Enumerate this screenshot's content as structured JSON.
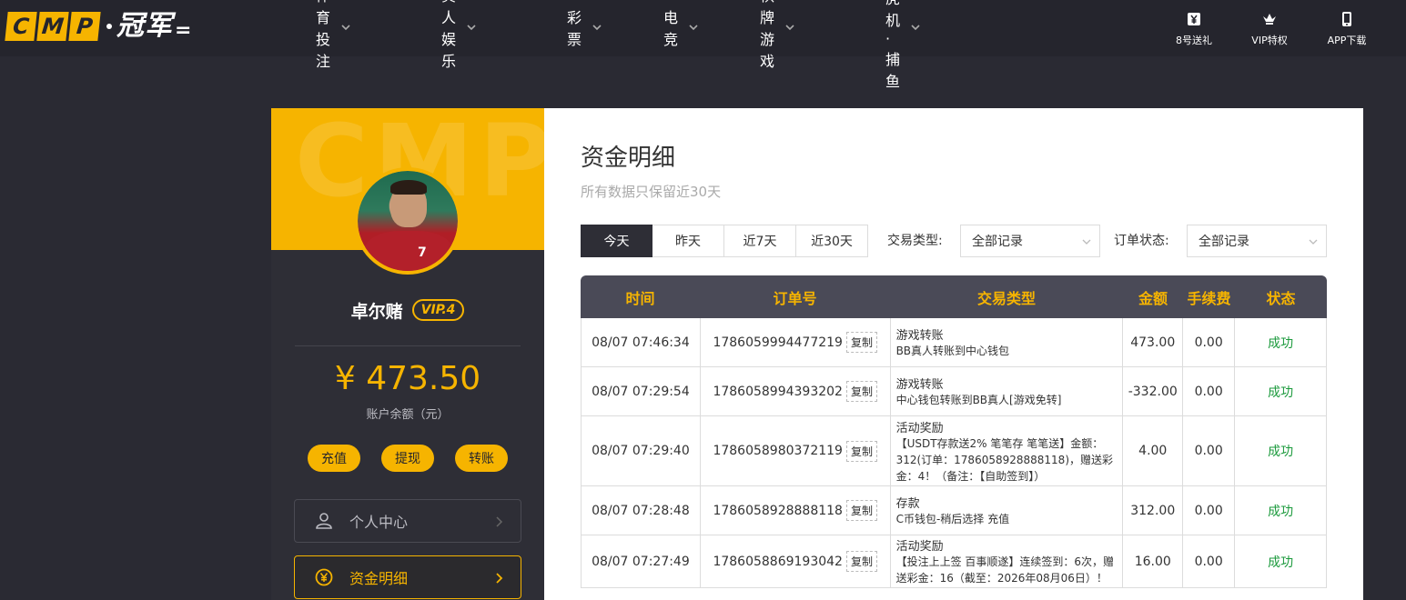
{
  "brand": {
    "logo_letters": [
      "C",
      "M",
      "P"
    ],
    "logo_cn": "冠军",
    "accent": "#f6b400"
  },
  "nav": {
    "items": [
      {
        "label": "体育投注"
      },
      {
        "label": "真人娱乐"
      },
      {
        "label": "彩票"
      },
      {
        "label": "电竞"
      },
      {
        "label": "棋牌游戏"
      },
      {
        "label": "老虎机·捕鱼"
      }
    ],
    "tools": [
      {
        "label": "8号送礼",
        "icon": "ticket-icon"
      },
      {
        "label": "VIP特权",
        "icon": "crown-icon"
      },
      {
        "label": "APP下载",
        "icon": "phone-icon"
      }
    ]
  },
  "profile": {
    "watermark": "CMP",
    "username": "卓尔赌",
    "vip": "VIP.4",
    "balance": "¥ 473.50",
    "balance_label": "账户余额（元）",
    "actions": {
      "deposit": "充值",
      "withdraw": "提现",
      "transfer": "转账"
    },
    "menu": [
      {
        "label": "个人中心",
        "icon": "user-icon",
        "active": false
      },
      {
        "label": "资金明细",
        "icon": "yen-coin-icon",
        "active": true
      }
    ]
  },
  "main": {
    "title": "资金明细",
    "subtitle": "所有数据只保留近30天",
    "tabs": [
      "今天",
      "昨天",
      "近7天",
      "近30天"
    ],
    "active_tab": "今天",
    "type_filter_label": "交易类型:",
    "type_filter_value": "全部记录",
    "status_filter_label": "订单状态:",
    "status_filter_value": "全部记录",
    "table": {
      "headers": [
        "时间",
        "订单号",
        "交易类型",
        "金额",
        "手续费",
        "状态"
      ],
      "copy_label": "复制",
      "rows": [
        {
          "time": "08/07 07:46:34",
          "order": "1786059994477219",
          "type": "游戏转账",
          "desc": "BB真人转账到中心钱包",
          "amount": "473.00",
          "fee": "0.00",
          "status": "成功"
        },
        {
          "time": "08/07 07:29:54",
          "order": "1786058994393202",
          "type": "游戏转账",
          "desc": "中心钱包转账到BB真人[游戏免转]",
          "amount": "-332.00",
          "fee": "0.00",
          "status": "成功"
        },
        {
          "time": "08/07 07:29:40",
          "order": "1786058980372119",
          "type": "活动奖励",
          "desc": "【USDT存款送2% 笔笔存 笔笔送】金额：312(订单：1786058928888118)，赠送彩金：4！（备注：【自助签到】）",
          "amount": "4.00",
          "fee": "0.00",
          "status": "成功"
        },
        {
          "time": "08/07 07:28:48",
          "order": "1786058928888118",
          "type": "存款",
          "desc": "C币钱包-稍后选择 充值",
          "amount": "312.00",
          "fee": "0.00",
          "status": "成功"
        },
        {
          "time": "08/07 07:27:49",
          "order": "1786058869193042",
          "type": "活动奖励",
          "desc": "【投注上上签 百事顺遂】连续签到：6次，赠送彩金：16（截至：2026年08月06日）！",
          "amount": "16.00",
          "fee": "0.00",
          "status": "成功"
        }
      ]
    }
  }
}
